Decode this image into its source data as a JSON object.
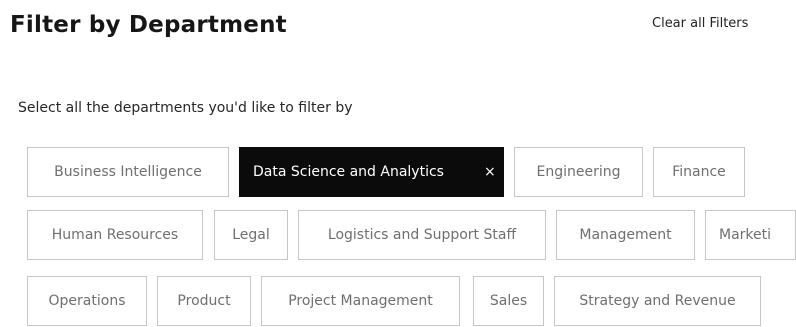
{
  "header": {
    "title": "Filter by Department",
    "clear_all_label": "Clear all Filters"
  },
  "instructions": "Select all the departments you'd like to filter by",
  "departments": [
    {
      "label": "Business Intelligence",
      "selected": false
    },
    {
      "label": "Data Science and Analytics",
      "selected": true
    },
    {
      "label": "Engineering",
      "selected": false
    },
    {
      "label": "Finance",
      "selected": false
    },
    {
      "label": "Human Resources",
      "selected": false
    },
    {
      "label": "Legal",
      "selected": false
    },
    {
      "label": "Logistics and Support Staff",
      "selected": false
    },
    {
      "label": "Management",
      "selected": false
    },
    {
      "label": "Marketi",
      "selected": false
    },
    {
      "label": "Operations",
      "selected": false
    },
    {
      "label": "Product",
      "selected": false
    },
    {
      "label": "Project Management",
      "selected": false
    },
    {
      "label": "Sales",
      "selected": false
    },
    {
      "label": "Strategy and Revenue",
      "selected": false
    }
  ],
  "remove_glyph": "×",
  "colors": {
    "selected_bg": "#0b0b0b",
    "selected_text": "#ffffff",
    "chip_border": "#c6c6c6",
    "chip_text": "#6f6f6f"
  }
}
